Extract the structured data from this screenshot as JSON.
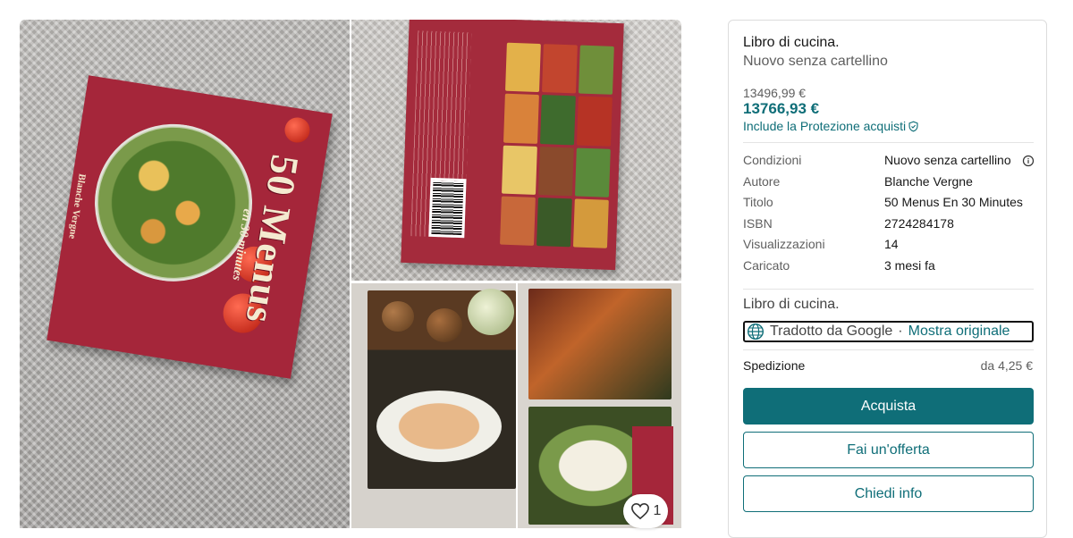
{
  "gallery": {
    "cover": {
      "title": "50 Menus",
      "subtitle": "en 30 minutes",
      "author": "Blanche Vergne"
    },
    "favorites": {
      "count": "1"
    }
  },
  "item": {
    "title": "Libro di cucina.",
    "condition_subtitle": "Nuovo senza cartellino",
    "price": "13496,99 €",
    "price_with_protection": "13766,93 €",
    "protection_label": "Include la Protezione acquisti"
  },
  "details": [
    {
      "key": "Condizioni",
      "value": "Nuovo senza cartellino"
    },
    {
      "key": "Autore",
      "value": "Blanche Vergne"
    },
    {
      "key": "Titolo",
      "value": "50 Menus En 30 Minutes"
    },
    {
      "key": "ISBN",
      "value": "2724284178"
    },
    {
      "key": "Visualizzazioni",
      "value": "14"
    },
    {
      "key": "Caricato",
      "value": "3 mesi fa"
    }
  ],
  "description": {
    "text": "Libro di cucina.",
    "translated_by": "Tradotto da Google",
    "separator": "·",
    "show_original": "Mostra originale"
  },
  "shipping": {
    "label": "Spedizione",
    "value": "da 4,25 €"
  },
  "actions": {
    "buy": "Acquista",
    "offer": "Fai un'offerta",
    "ask": "Chiedi info"
  },
  "colors": {
    "accent": "#0f6e78",
    "book_red": "#a5263a"
  }
}
